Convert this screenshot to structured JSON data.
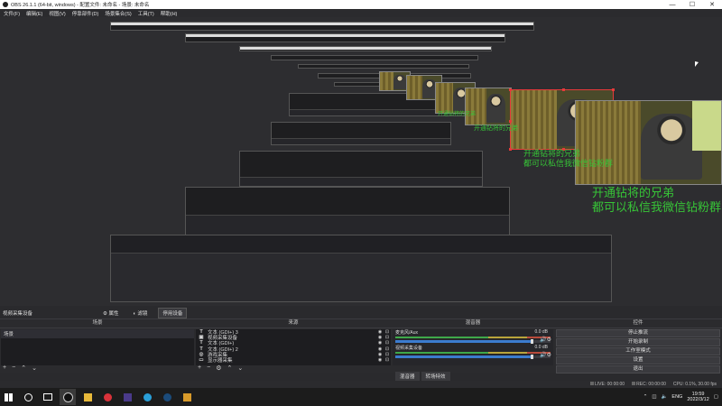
{
  "window": {
    "title": "OBS 26.1.1 (64-bit, windows) - 配置文件: 未命名 - 场景: 未命名",
    "min": "—",
    "max": "☐",
    "close": "✕"
  },
  "menu": [
    "文件(F)",
    "编辑(E)",
    "视图(V)",
    "停靠部件(D)",
    "场景集合(S)",
    "工具(T)",
    "帮助(H)"
  ],
  "overlay_text": {
    "line1": "开通钻将的兄弟",
    "line2": "都可以私信我微信钻粉群"
  },
  "source_label": "视频采集设备",
  "controls": {
    "properties": "属性",
    "filters": "滤镜",
    "deactivate": "停用设备"
  },
  "scenes": {
    "header": "场景",
    "items": [
      "场景"
    ]
  },
  "sources": {
    "header": "来源",
    "items": [
      {
        "type": "T",
        "name": "文本 (GDI+) 3"
      },
      {
        "type": "▣",
        "name": "视频采集设备"
      },
      {
        "type": "T",
        "name": "文本 (GDI+)"
      },
      {
        "type": "T",
        "name": "文本 (GDI+) 2"
      },
      {
        "type": "◎",
        "name": "游戏采集"
      },
      {
        "type": "▭",
        "name": "显示器采集"
      }
    ]
  },
  "mixer": {
    "header": "混音器",
    "channels": [
      {
        "name": "麦克风/Aux",
        "db": "0.0 dB"
      },
      {
        "name": "视频采集设备",
        "db": "0.0 dB"
      }
    ],
    "tabs": [
      "混音器",
      "转场特效"
    ]
  },
  "controls_panel": {
    "header": "控件",
    "buttons": [
      "停止推流",
      "开始录制",
      "工作室模式",
      "设置",
      "退出"
    ]
  },
  "status": {
    "live": "LIVE: 00:00:00",
    "rec": "REC: 00:00:00",
    "cpu": "CPU: 0.1%, 30.00 fps"
  },
  "taskbar": {
    "lang": "ENG",
    "time": "19:59",
    "date": "2022/3/12"
  },
  "colors": {
    "accent_text": "#37c437",
    "selection": "#e53a3a",
    "fader": "#3b7ccf"
  }
}
